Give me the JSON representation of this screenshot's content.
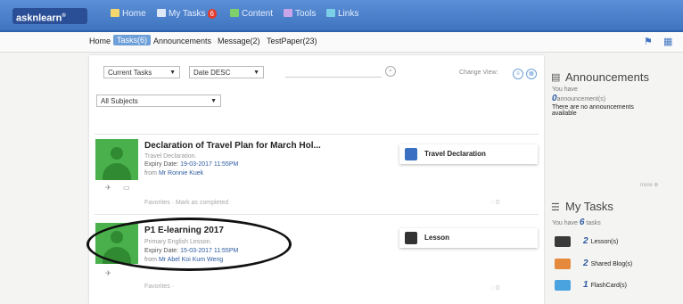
{
  "app": {
    "logo": "asknlearn",
    "logo_mark": "®"
  },
  "nav": [
    {
      "label": "Home",
      "icon": "home-icon",
      "color": "#f5d76e"
    },
    {
      "label": "My Tasks",
      "icon": "tasks-icon",
      "badge": "6",
      "color": "#dfe8f7"
    },
    {
      "label": "Content",
      "icon": "content-icon",
      "color": "#7fcf6b"
    },
    {
      "label": "Tools",
      "icon": "tools-icon",
      "color": "#c9a4e8"
    },
    {
      "label": "Links",
      "icon": "links-icon",
      "color": "#7bd0e8"
    }
  ],
  "subnav": [
    "Home",
    "Tasks(6)",
    "Announcements",
    "Message(2)",
    "TestPaper(23)"
  ],
  "filters": {
    "tasks": "Current Tasks",
    "sort": "Date DESC",
    "subject": "All Subjects",
    "change_view": "Change View:"
  },
  "tasks": [
    {
      "title": "Declaration of Travel Plan for March Hol...",
      "subtitle": "Travel Declaration.",
      "expiry_label": "Expiry Date:",
      "expiry": "19-03-2017 11:55PM",
      "from_label": "from",
      "from": "Mr Ronnie Kuek",
      "favorites": "Favorites",
      "mark": "Mark as completed",
      "comments": "0",
      "type": "Travel Declaration"
    },
    {
      "title": "P1 E-learning 2017",
      "subtitle": "Primary English Lesson.",
      "expiry_label": "Expiry Date:",
      "expiry": "15-03-2017 11:55PM",
      "from_label": "from",
      "from": "Mr Abel Koi Kum Weng",
      "favorites": "Favorites",
      "comments": "0",
      "type": "Lesson"
    }
  ],
  "announcements": {
    "title": "Announcements",
    "you_have": "You have",
    "count": "0",
    "unit": "announcement(s)",
    "none": "There are no announcements available",
    "more": "more"
  },
  "mytasks": {
    "title": "My Tasks",
    "you_have": "You have",
    "count": "6",
    "unit": "tasks",
    "items": [
      {
        "count": "2",
        "label": "Lesson(s)",
        "icon": "lesson-icon",
        "color": "#3a3a3a"
      },
      {
        "count": "2",
        "label": "Shared Blog(s)",
        "icon": "blog-icon",
        "color": "#e58a3c"
      },
      {
        "count": "1",
        "label": "FlashCard(s)",
        "icon": "flashcard-icon",
        "color": "#4aa3df"
      }
    ]
  }
}
